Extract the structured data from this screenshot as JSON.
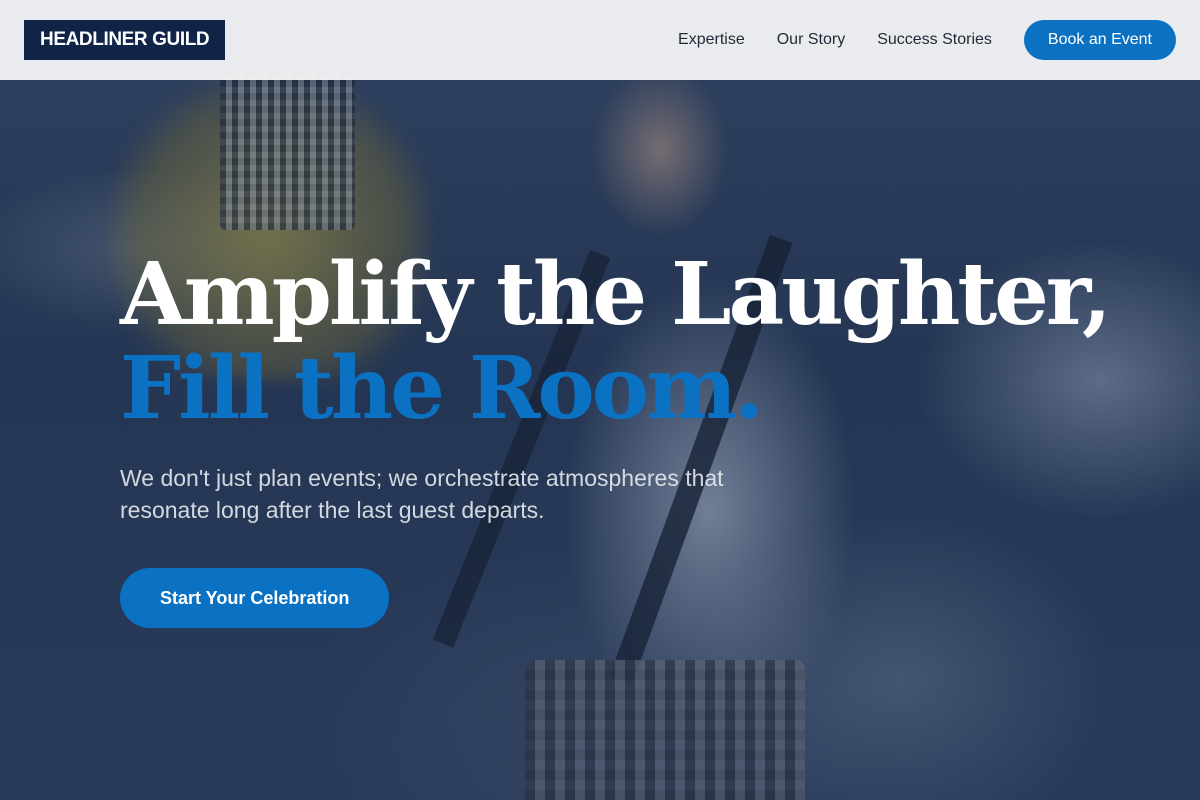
{
  "brand": {
    "logo_text": "HEADLINER GUILD",
    "primary_color": "#0b72c3",
    "logo_bg_color": "#0f2447"
  },
  "nav": {
    "links": [
      {
        "label": "Expertise"
      },
      {
        "label": "Our Story"
      },
      {
        "label": "Success Stories"
      }
    ],
    "cta_label": "Book an Event"
  },
  "hero": {
    "headline_line1": "Amplify the Laughter,",
    "headline_line2": "Fill the Room.",
    "subtext": "We don't just plan events; we orchestrate atmospheres that resonate long after the last guest departs.",
    "cta_label": "Start Your Celebration"
  }
}
